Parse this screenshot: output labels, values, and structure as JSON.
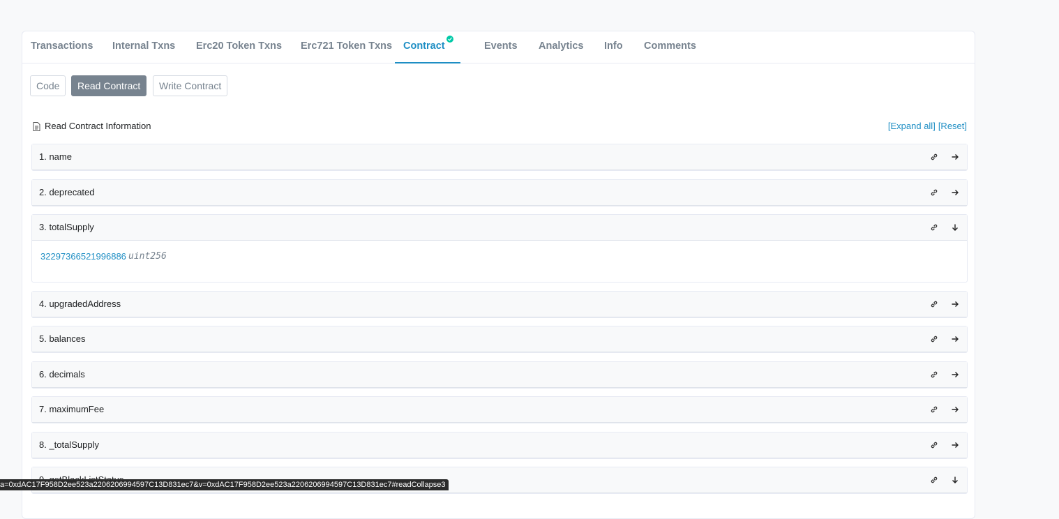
{
  "tabs": [
    {
      "label": "Transactions"
    },
    {
      "label": "Internal Txns"
    },
    {
      "label": "Erc20 Token Txns"
    },
    {
      "label": "Erc721 Token Txns"
    },
    {
      "label": "Contract"
    },
    {
      "label": "Events"
    },
    {
      "label": "Analytics"
    },
    {
      "label": "Info"
    },
    {
      "label": "Comments"
    }
  ],
  "active_tab": "Contract",
  "subtabs": {
    "code": "Code",
    "read": "Read Contract",
    "write": "Write Contract"
  },
  "read_contract": {
    "title": "Read Contract Information",
    "expand_all": "[Expand all]",
    "reset": "[Reset]"
  },
  "items": [
    {
      "label": "1. name"
    },
    {
      "label": "2. deprecated"
    },
    {
      "label": "3. totalSupply",
      "value": "32297366521996886",
      "type": "uint256",
      "expanded": true
    },
    {
      "label": "4. upgradedAddress"
    },
    {
      "label": "5. balances"
    },
    {
      "label": "6. decimals"
    },
    {
      "label": "7. maximumFee"
    },
    {
      "label": "8. _totalSupply"
    },
    {
      "label": "9. getBlackListStatus"
    }
  ],
  "status_url": "a=0xdAC17F958D2ee523a2206206994597C13D831ec7&v=0xdAC17F958D2ee523a2206206994597C13D831ec7#readCollapse3",
  "colors": {
    "accent": "#1e8ec4",
    "muted": "#77838f",
    "verified": "#00c9a7"
  }
}
